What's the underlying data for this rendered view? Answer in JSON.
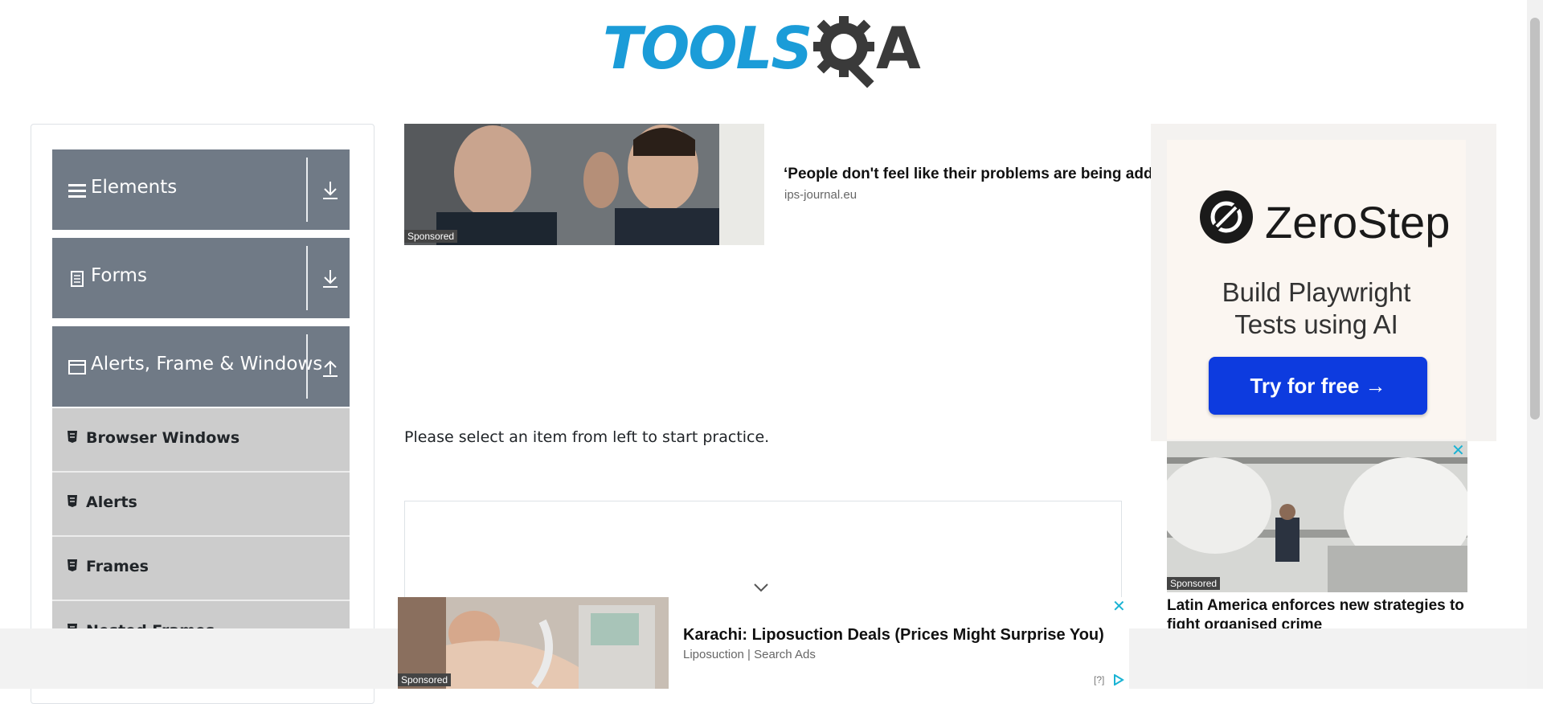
{
  "logo": {
    "text": "TOOLS",
    "suffix": "A"
  },
  "sidebar": {
    "groups": [
      {
        "label": "Elements",
        "icon": "hamburger-icon",
        "arrow": "download-arrow-icon"
      },
      {
        "label": "Forms",
        "icon": "document-icon",
        "arrow": "download-arrow-icon"
      },
      {
        "label": "Alerts, Frame & Windows",
        "icon": "window-icon",
        "arrow": "upload-arrow-icon"
      }
    ],
    "items": [
      {
        "label": "Browser Windows",
        "icon": "html5-icon"
      },
      {
        "label": "Alerts",
        "icon": "html5-icon"
      },
      {
        "label": "Frames",
        "icon": "html5-icon"
      },
      {
        "label": "Nested Frames",
        "icon": "html5-icon"
      }
    ]
  },
  "main_ad": {
    "sponsored": "Sponsored",
    "title": "‘People don't feel like their problems are being addressed’",
    "source": "ips-journal.eu"
  },
  "main": {
    "practice_text": "Please select an item from left to start practice."
  },
  "right_ad": {
    "brand": "ZeroStep",
    "headline_line1": "Build Playwright",
    "headline_line2": "Tests using AI",
    "button": "Try for free →"
  },
  "right_news": {
    "sponsored": "Sponsored",
    "close": "✕",
    "title": "Latin America enforces new strategies to fight organised crime"
  },
  "bottom_ad": {
    "sponsored": "Sponsored",
    "close": "✕",
    "title": "Karachi: Liposuction Deals (Prices Might Surprise You)",
    "source": "Liposuction | Search Ads",
    "help": "[?]"
  },
  "colors": {
    "logo_blue": "#1b9cd8",
    "logo_dark": "#3a3a3a",
    "group_header": "#707a86",
    "sub_item": "#cccccc",
    "cta_blue": "#0d3bdf",
    "close_cyan": "#1ab3d4"
  }
}
